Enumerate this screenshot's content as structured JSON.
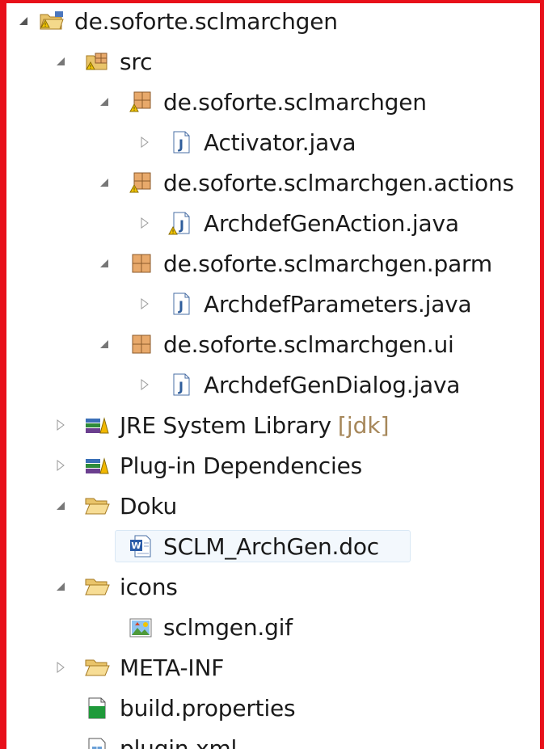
{
  "tree": {
    "project": {
      "label": "de.soforte.sclmarchgen"
    },
    "src": {
      "label": "src"
    },
    "pkg_root": {
      "label": "de.soforte.sclmarchgen"
    },
    "activator": {
      "label": "Activator.java"
    },
    "pkg_actions": {
      "label": "de.soforte.sclmarchgen.actions"
    },
    "archdef_gen_action": {
      "label": "ArchdefGenAction.java"
    },
    "pkg_parm": {
      "label": "de.soforte.sclmarchgen.parm"
    },
    "archdef_parameters": {
      "label": "ArchdefParameters.java"
    },
    "pkg_ui": {
      "label": "de.soforte.sclmarchgen.ui"
    },
    "archdef_gen_dialog": {
      "label": "ArchdefGenDialog.java"
    },
    "jre": {
      "label": "JRE System Library",
      "decoration": "[jdk]"
    },
    "plugin_deps": {
      "label": "Plug-in Dependencies"
    },
    "doku": {
      "label": "Doku"
    },
    "sclm_doc": {
      "label": "SCLM_ArchGen.doc"
    },
    "icons": {
      "label": "icons"
    },
    "sclmgen_gif": {
      "label": "sclmgen.gif"
    },
    "meta_inf": {
      "label": "META-INF"
    },
    "build_properties": {
      "label": "build.properties"
    },
    "plugin_xml": {
      "label": "plugin.xml"
    }
  },
  "colors": {
    "frame_border": "#e8101a",
    "selection_bg": "#f3f8fd",
    "decoration_text": "#a6875a"
  }
}
